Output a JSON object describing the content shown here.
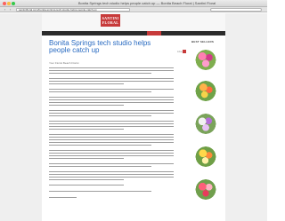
{
  "window": {
    "title": "Bonita Springs tech studio helps people catch up — Bonita Beach Floral | Santini Floral",
    "url": "santinifloral.com/bonita-springs-tech-studio-helps-people-catch-up"
  },
  "header": {
    "logo_line1": "SANTINI",
    "logo_line2": "FLORAL"
  },
  "article": {
    "headline_line1": "Bonita Springs tech studio helps",
    "headline_line2": "people catch up",
    "share_label": "Like",
    "byline": "Your Florist Beach Florist"
  },
  "sidebar": {
    "heading": "BEST SELLERS"
  },
  "colors": {
    "accent": "#c73a3a",
    "link": "#2a6bc1",
    "navbar": "#2b2b2b"
  },
  "icons": [
    "close-icon",
    "minimize-icon",
    "maximize-icon",
    "back-icon",
    "forward-icon"
  ]
}
